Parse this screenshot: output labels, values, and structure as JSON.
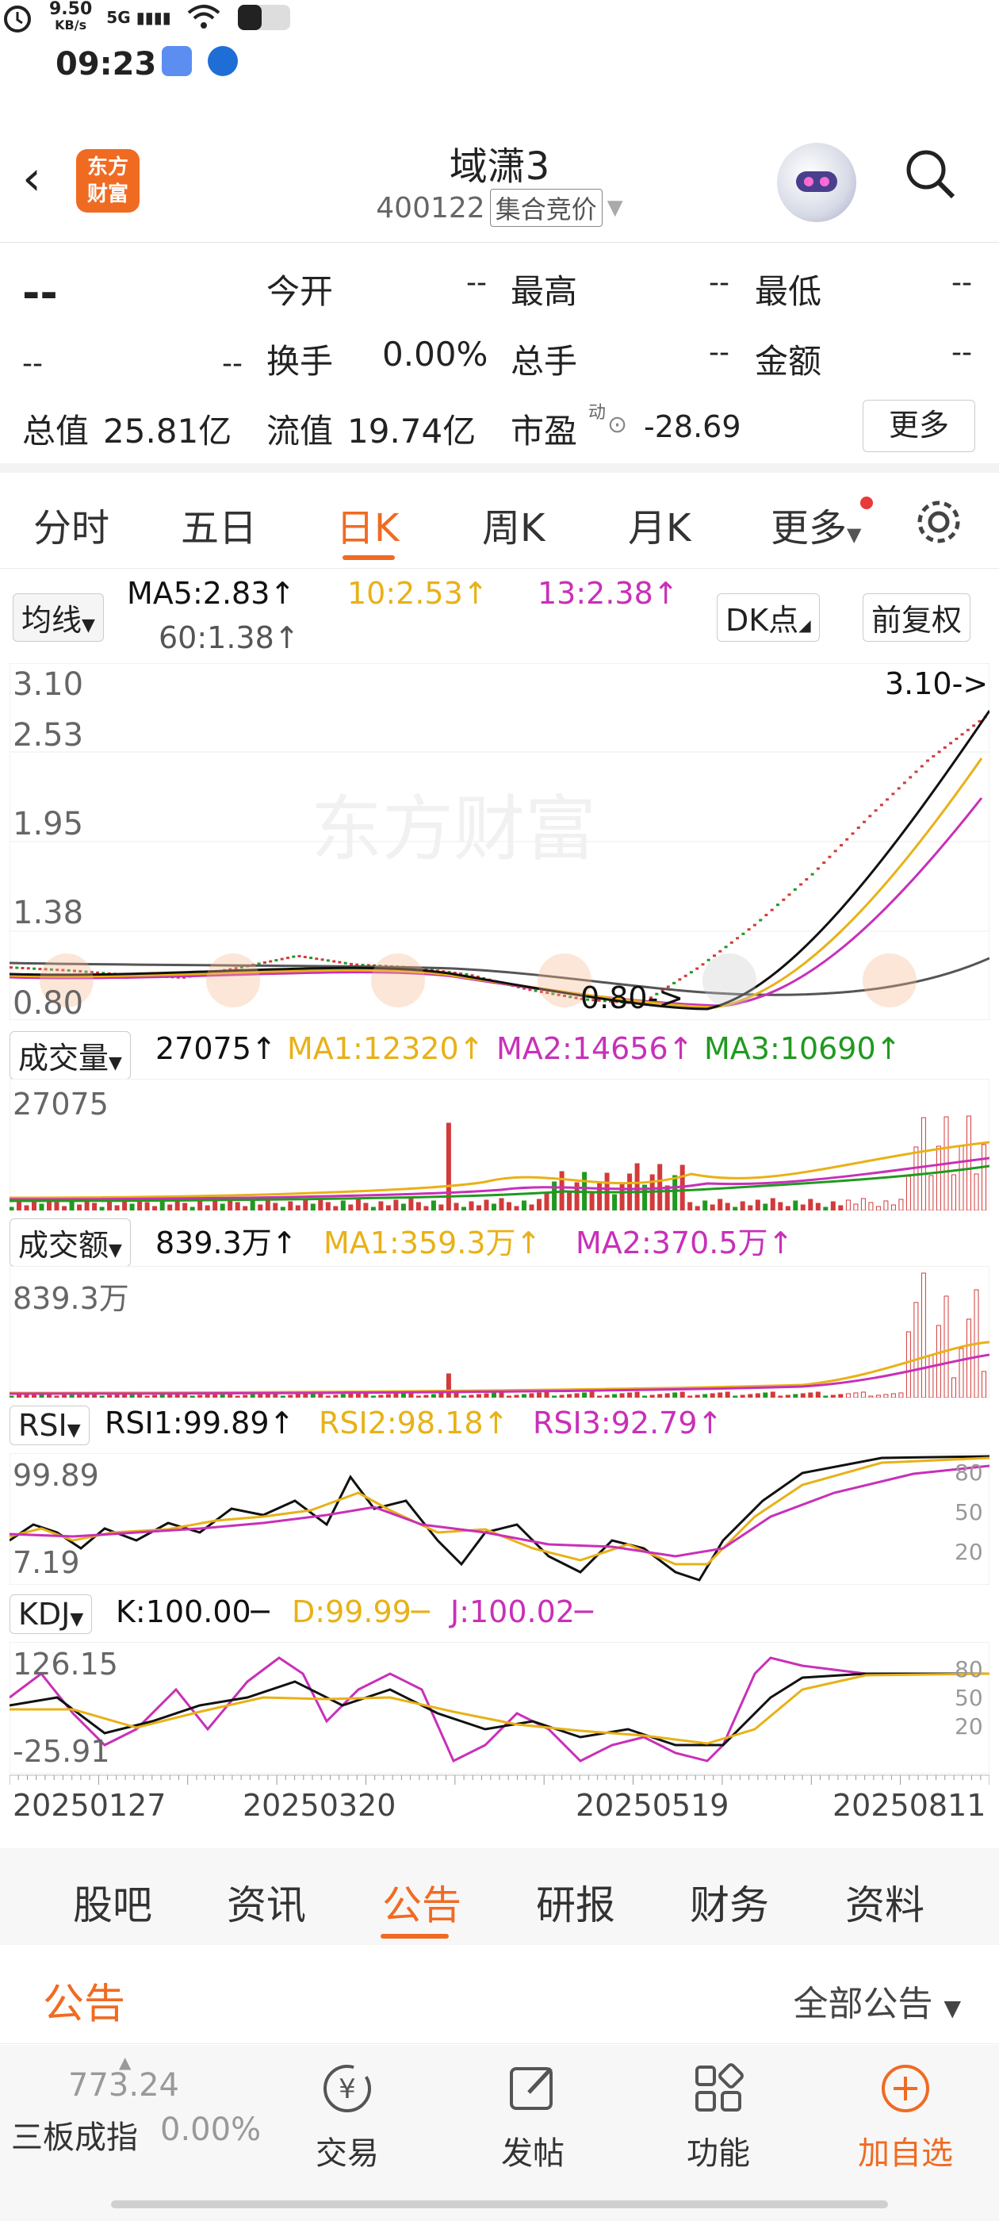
{
  "status": {
    "time": "09:23",
    "net_speed_top": "9.50",
    "net_speed_bottom": "KB/s",
    "signal": "5G"
  },
  "header": {
    "back": "‹",
    "logo_line1": "东方",
    "logo_line2": "财富",
    "name": "域潇3",
    "code": "400122",
    "market": "集合竞价"
  },
  "quote": {
    "price": "--",
    "change": "--",
    "change_pct": "--",
    "open_label": "今开",
    "open": "--",
    "high_label": "最高",
    "high": "--",
    "low_label": "最低",
    "low": "--",
    "turnover_label": "换手",
    "turnover": "0.00%",
    "volume_label": "总手",
    "volume": "--",
    "amount_label": "金额",
    "amount": "--",
    "mktcap_label": "总值",
    "mktcap": "25.81亿",
    "float_label": "流值",
    "float": "19.74亿",
    "pe_label": "市盈",
    "pe_sup": "动",
    "pe": "-28.69",
    "more": "更多"
  },
  "period_tabs": [
    "分时",
    "五日",
    "日K",
    "周K",
    "月K",
    "更多"
  ],
  "ma_bar": {
    "chip": "均线",
    "ma5": "MA5:2.83",
    "ma10": "10:2.53",
    "ma13": "13:2.38",
    "ma60": "60:1.38",
    "dk": "DK点",
    "fq": "前复权"
  },
  "price_axis": {
    "top": "3.10",
    "l2": "2.53",
    "l3": "1.95",
    "l4": "1.38",
    "bottom": "0.80",
    "max_marker": "3.10->",
    "min_marker": "0.80->",
    "watermark": "东方财富"
  },
  "volume_panel": {
    "chip": "成交量",
    "value": "27075",
    "ma1": "MA1:12320",
    "ma2": "MA2:14656",
    "ma3": "MA3:10690",
    "axis_top": "27075"
  },
  "amount_panel": {
    "chip": "成交额",
    "value": "839.3万",
    "ma1": "MA1:359.3万",
    "ma2": "MA2:370.5万",
    "axis_top": "839.3万"
  },
  "rsi_panel": {
    "chip": "RSI",
    "rsi1": "RSI1:99.89",
    "rsi2": "RSI2:98.18",
    "rsi3": "RSI3:92.79",
    "axis_top": "99.89",
    "axis_bottom": "7.19",
    "l80": "80",
    "l50": "50",
    "l20": "20"
  },
  "kdj_panel": {
    "chip": "KDJ",
    "k": "K:100.00",
    "d": "D:99.99",
    "j": "J:100.02",
    "axis_top": "126.15",
    "axis_bottom": "-25.91",
    "l80": "80",
    "l50": "50",
    "l20": "20"
  },
  "dates": [
    "20250127",
    "20250320",
    "20250519",
    "20250811"
  ],
  "content_tabs": [
    "股吧",
    "资讯",
    "公告",
    "研报",
    "财务",
    "资料"
  ],
  "notice": {
    "title": "公告",
    "filter": "全部公告"
  },
  "toolbar": {
    "index_value": "773.24",
    "index_name": "三板成指",
    "index_change": "0.00%",
    "items": [
      "交易",
      "发帖",
      "功能",
      "加自选"
    ]
  },
  "colors": {
    "accent": "#f06b22",
    "up": "#d23b3b",
    "down": "#1f9a1f",
    "ma_yellow": "#e8b117",
    "ma_magenta": "#c830b8"
  },
  "chart_data": {
    "type": "candlestick",
    "price_range": [
      0.8,
      3.1
    ],
    "ma_close_approx": [
      1.1,
      1.08,
      1.05,
      1.03,
      1.1,
      1.18,
      1.12,
      1.1,
      1.05,
      0.95,
      0.88,
      0.85,
      1.1,
      1.4,
      1.75,
      2.15,
      2.53,
      2.83
    ]
  }
}
